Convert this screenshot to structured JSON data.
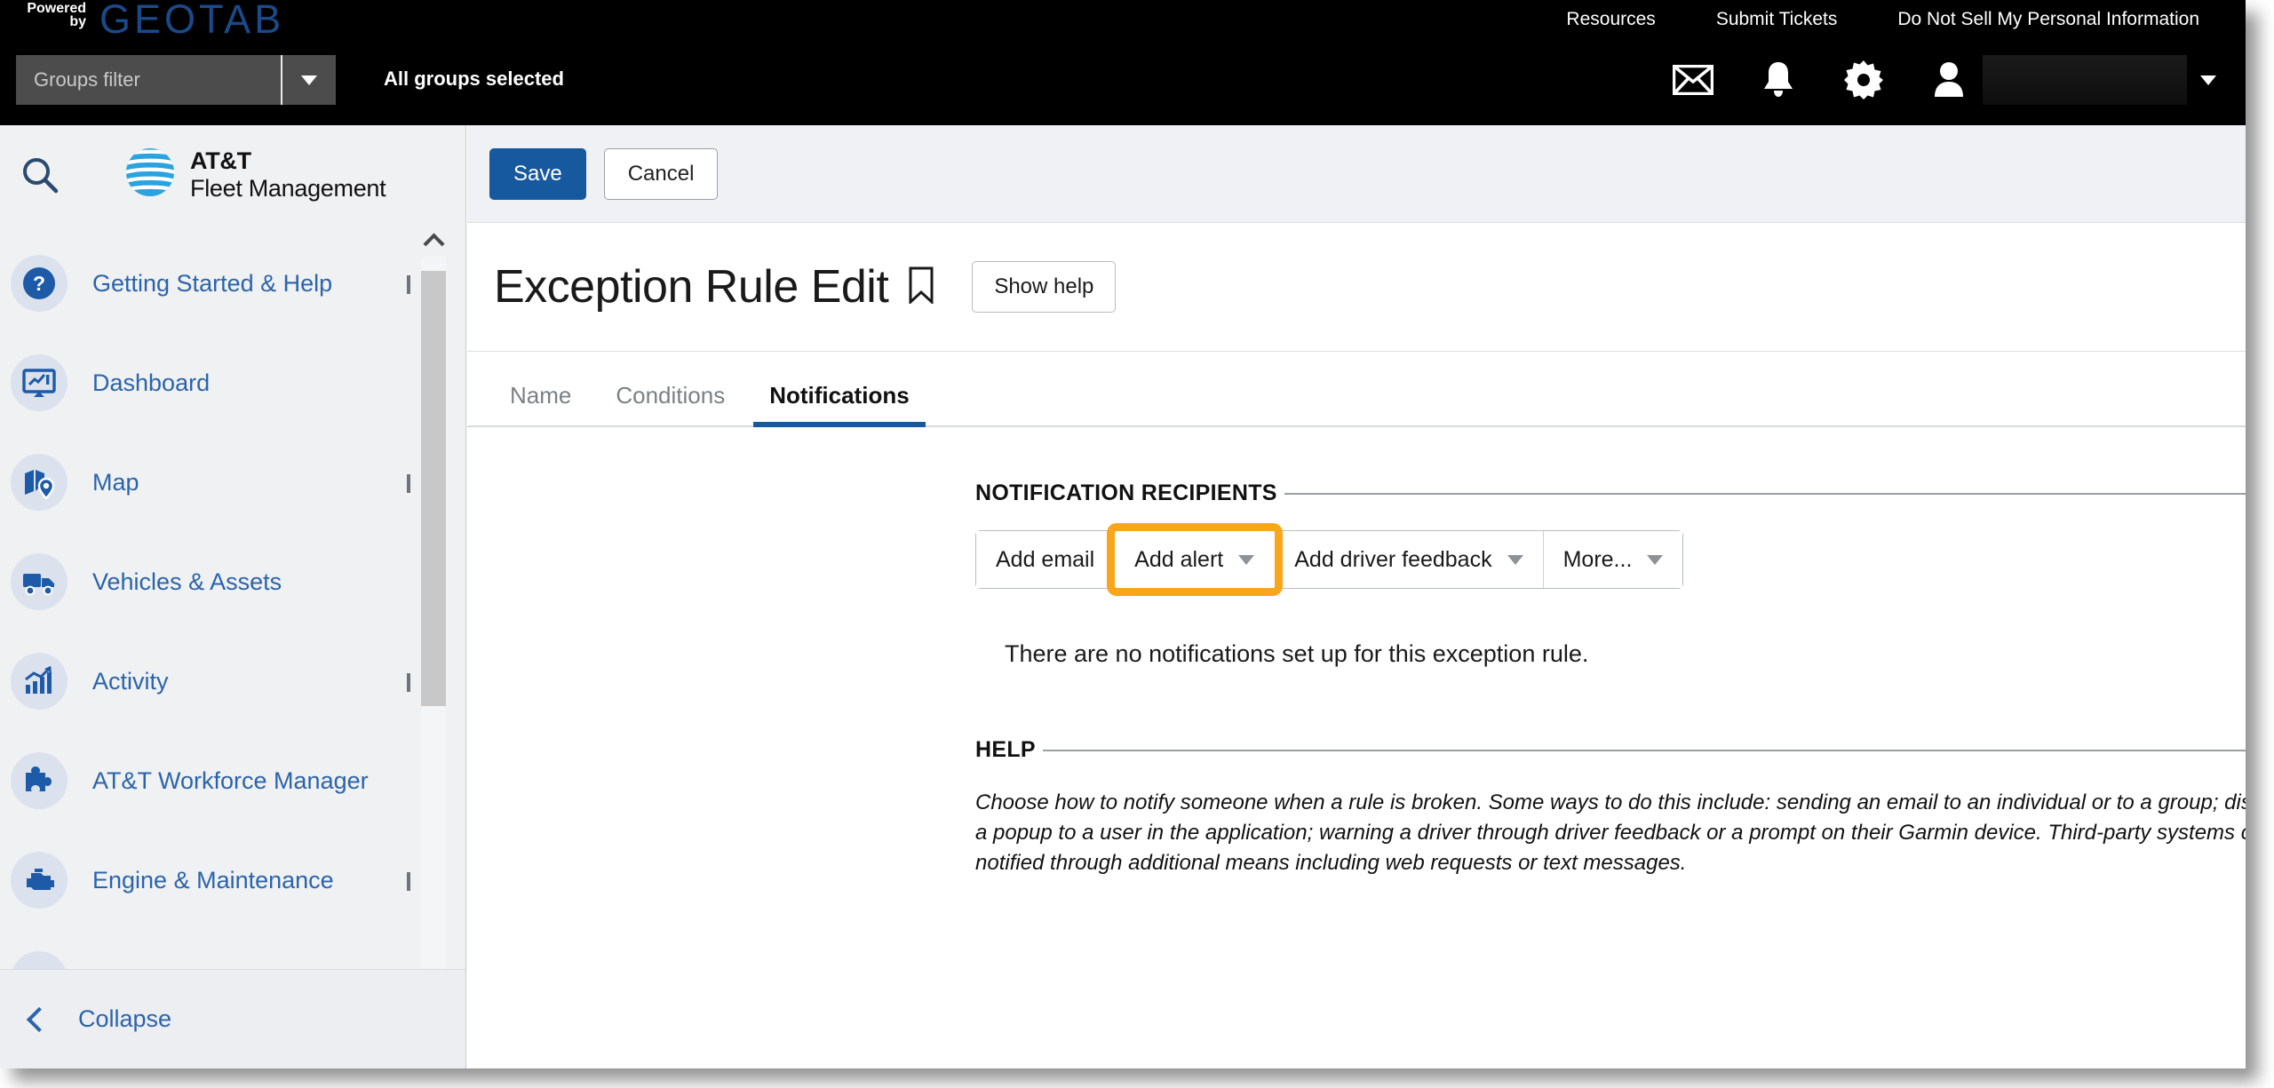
{
  "topbar": {
    "powered_line1": "Powered",
    "powered_line2": "by",
    "logo_word": "GEOTAB",
    "links": [
      {
        "label": "Resources"
      },
      {
        "label": "Submit Tickets"
      },
      {
        "label": "Do Not Sell My Personal Information"
      }
    ],
    "groups_filter_placeholder": "Groups filter",
    "groups_status": "All groups selected",
    "icons": [
      {
        "name": "mail-icon"
      },
      {
        "name": "bell-icon"
      },
      {
        "name": "gear-icon"
      },
      {
        "name": "user-icon"
      }
    ],
    "user_name": ""
  },
  "sidebar": {
    "search_icon": "search-icon",
    "brand_line1": "AT&T",
    "brand_line2": "Fleet Management",
    "items": [
      {
        "label": "Getting Started & Help",
        "icon": "question-circle-icon",
        "expandable": true
      },
      {
        "label": "Dashboard",
        "icon": "dashboard-monitor-icon",
        "expandable": false
      },
      {
        "label": "Map",
        "icon": "map-pin-icon",
        "expandable": true
      },
      {
        "label": "Vehicles & Assets",
        "icon": "truck-icon",
        "expandable": false
      },
      {
        "label": "Activity",
        "icon": "activity-chart-icon",
        "expandable": true
      },
      {
        "label": "AT&T Workforce Manager",
        "icon": "puzzle-piece-icon",
        "expandable": false
      },
      {
        "label": "Engine & Maintenance",
        "icon": "engine-icon",
        "expandable": true
      }
    ],
    "collapse_label": "Collapse"
  },
  "toolbar": {
    "save_label": "Save",
    "cancel_label": "Cancel"
  },
  "page": {
    "title": "Exception Rule Edit",
    "bookmark_icon": "bookmark-icon",
    "show_help_label": "Show help"
  },
  "tabs": [
    {
      "label": "Name",
      "active": false
    },
    {
      "label": "Conditions",
      "active": false
    },
    {
      "label": "Notifications",
      "active": true
    }
  ],
  "notification_recipients": {
    "legend": "NOTIFICATION RECIPIENTS",
    "buttons": [
      {
        "label": "Add email",
        "has_caret": false,
        "highlighted": false
      },
      {
        "label": "Add alert",
        "has_caret": true,
        "highlighted": true
      },
      {
        "label": "Add driver feedback",
        "has_caret": true,
        "highlighted": false
      },
      {
        "label": "More...",
        "has_caret": true,
        "highlighted": false
      }
    ],
    "empty_message": "There are no notifications set up for this exception rule."
  },
  "help": {
    "legend": "HELP",
    "body": "Choose how to notify someone when a rule is broken. Some ways to do this include: sending an email to an individual or to a group; displaying a popup to a user in the application; warning a driver through driver feedback or a prompt on their Garmin device. Third-party systems can be notified through additional means including web requests or text messages."
  },
  "colors": {
    "accent_blue": "#17599e",
    "link_blue": "#2b64ab",
    "highlight_orange": "#f9a61a",
    "topbar_black": "#000000",
    "sidebar_gray": "#f0f1f3"
  }
}
